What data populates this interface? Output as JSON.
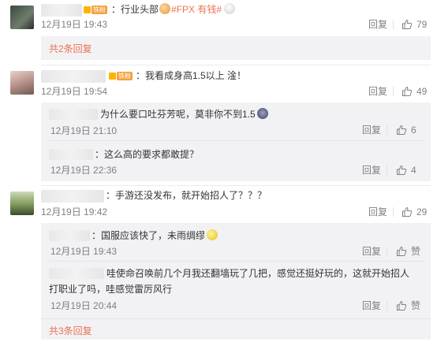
{
  "comments": [
    {
      "text_prefix": "：行业头部",
      "text_hash": "#FPX 有钱#",
      "badge_label": "铁粉",
      "time": "12月19日 19:43",
      "reply_label": "回复",
      "likes": "79",
      "more_replies": "共2条回复"
    },
    {
      "text": "：我看成身高1.5以上  淦！",
      "badge_label": "铁粉",
      "time": "12月19日 19:54",
      "reply_label": "回复",
      "likes": "49",
      "replies": [
        {
          "text": "为什么要口吐芬芳呢，莫非你不到1.5",
          "time": "12月19日 21:10",
          "reply_label": "回复",
          "likes": "6"
        },
        {
          "text": "：这么高的要求都敢提？",
          "time": "12月19日 22:36",
          "reply_label": "回复",
          "likes": "4"
        }
      ]
    },
    {
      "text": "：手游还没发布，就开始招人了？？？",
      "time": "12月19日 19:42",
      "reply_label": "回复",
      "likes": "29",
      "replies": [
        {
          "text": "：国服应该快了，未雨绸缪",
          "time": "12月19日 19:43",
          "reply_label": "回复",
          "likes": "赞"
        },
        {
          "text_line1": "哇使命召唤前几个月我还翻墙玩了几把，感觉还挺好玩的，这就开始招人",
          "text_line2": "打职业了吗，哇感觉雷厉风行",
          "time": "12月19日 20:44",
          "reply_label": "回复",
          "likes": "赞"
        }
      ],
      "more_replies": "共3条回复"
    }
  ],
  "colors": {
    "accent": "#eb7350",
    "meta": "#808080",
    "sub_bg": "#f2f2f5"
  }
}
